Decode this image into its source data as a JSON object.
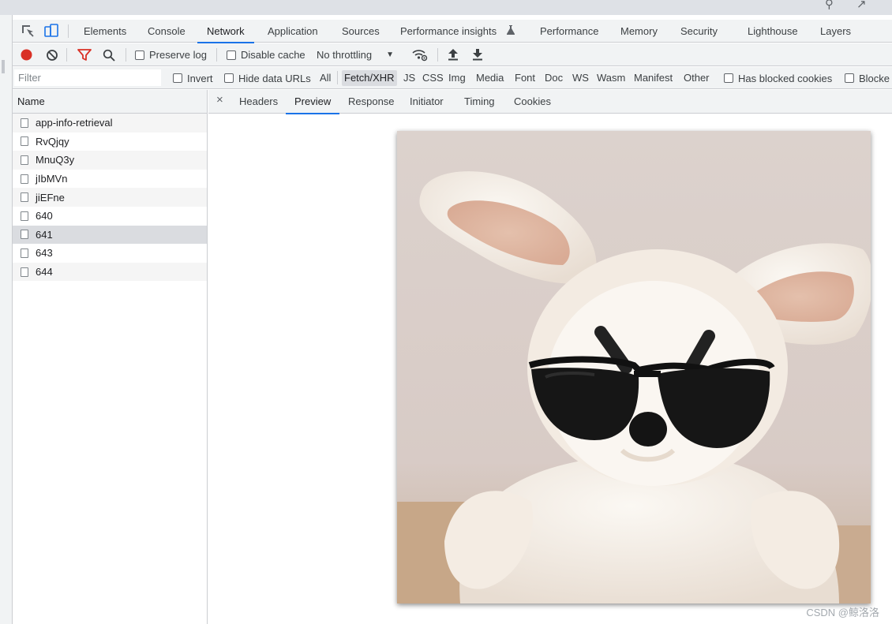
{
  "main_tabs": [
    "Elements",
    "Console",
    "Network",
    "Application",
    "Sources",
    "Performance insights",
    "Performance",
    "Memory",
    "Security",
    "Lighthouse",
    "Layers"
  ],
  "active_main_tab": "Network",
  "toolbar": {
    "preserve_log": "Preserve log",
    "disable_cache": "Disable cache",
    "throttling": "No throttling"
  },
  "filter": {
    "placeholder": "Filter",
    "invert": "Invert",
    "hide_data_urls": "Hide data URLs",
    "types": [
      "All",
      "Fetch/XHR",
      "JS",
      "CSS",
      "Img",
      "Media",
      "Font",
      "Doc",
      "WS",
      "Wasm",
      "Manifest",
      "Other"
    ],
    "active_type": "Fetch/XHR",
    "has_blocked_cookies": "Has blocked cookies",
    "blocked_requests": "Blocke"
  },
  "request_list": {
    "header": "Name",
    "rows": [
      "app-info-retrieval",
      "RvQjqy",
      "MnuQ3y",
      "jIbMVn",
      "jiEFne",
      "640",
      "641",
      "643",
      "644"
    ],
    "selected": "641"
  },
  "detail_tabs": [
    "Headers",
    "Preview",
    "Response",
    "Initiator",
    "Timing",
    "Cookies"
  ],
  "active_detail_tab": "Preview",
  "preview_image": "plush-bunny-with-sunglasses",
  "watermark": "CSDN @鲸洛洛",
  "colors": {
    "accent": "#1a73e8",
    "record": "#d93025",
    "filter_active": "#d93025"
  }
}
